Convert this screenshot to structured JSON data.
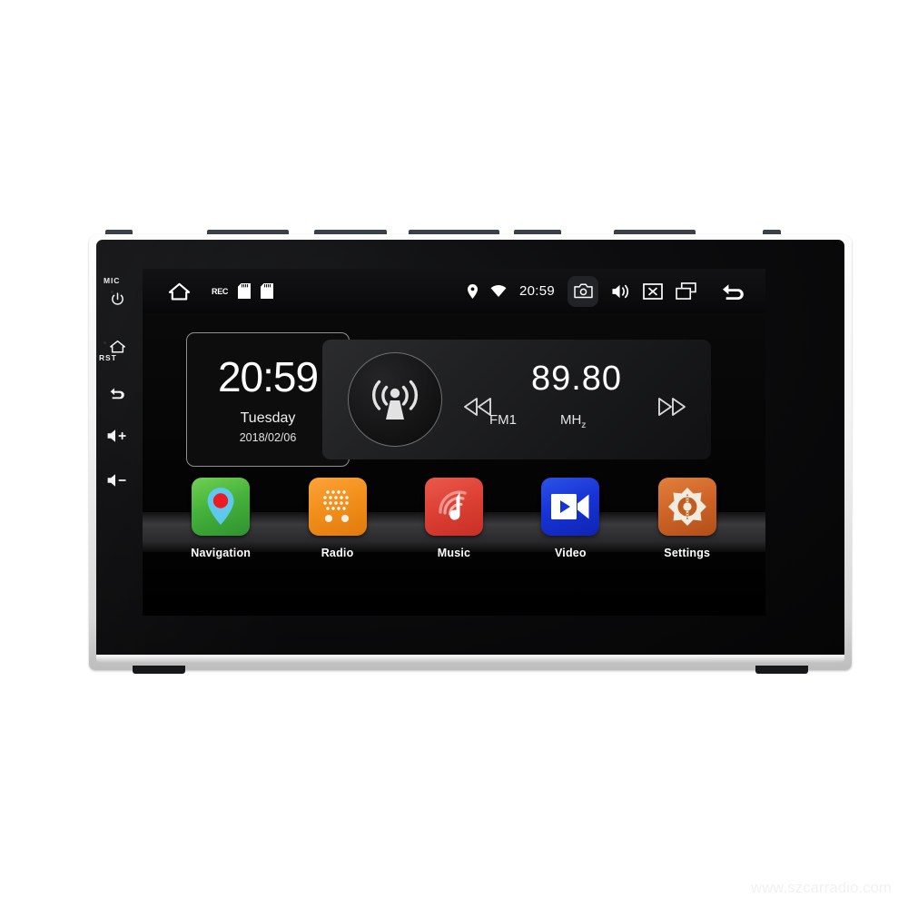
{
  "device": {
    "name": "android-car-stereo-head-unit",
    "bezel": {
      "mic_label": "MIC",
      "rst_label": "RST",
      "buttons": [
        {
          "name": "power-button",
          "icon": "power-icon"
        },
        {
          "name": "home-button",
          "icon": "home-icon"
        },
        {
          "name": "back-button",
          "icon": "back-arrow-icon"
        },
        {
          "name": "volume-up-button",
          "icon": "volume-up-icon"
        },
        {
          "name": "volume-down-button",
          "icon": "volume-down-icon"
        }
      ]
    }
  },
  "statusbar": {
    "home_icon": "home-icon",
    "rec_label": "REC",
    "sdcard1_icon": "sd-card-icon",
    "sdcard2_icon": "sd-card-icon",
    "location_icon": "location-pin-icon",
    "wifi_icon": "wifi-icon",
    "time": "20:59",
    "camera_icon": "camera-icon",
    "volume_icon": "speaker-icon",
    "close_icon": "close-box-icon",
    "recents_icon": "recent-apps-icon",
    "back_icon": "back-arrow-icon"
  },
  "clock_widget": {
    "time": "20:59",
    "day": "Tuesday",
    "date": "2018/02/06"
  },
  "radio_widget": {
    "antenna_icon": "broadcast-antenna-icon",
    "frequency": "89.80",
    "band": "FM1",
    "unit_main": "MH",
    "unit_sub": "z",
    "prev_icon": "seek-backward-icon",
    "next_icon": "seek-forward-icon"
  },
  "dock": {
    "apps": [
      {
        "label": "Navigation",
        "icon": "map-pin-icon",
        "color": "#3faa38"
      },
      {
        "label": "Radio",
        "icon": "radio-grille-icon",
        "color": "#f18a17"
      },
      {
        "label": "Music",
        "icon": "music-note-icon",
        "color": "#df3b31"
      },
      {
        "label": "Video",
        "icon": "video-camera-icon",
        "color": "#1336d8"
      },
      {
        "label": "Settings",
        "icon": "gear-icon",
        "color": "#d4692c"
      }
    ]
  },
  "watermark": {
    "text": "www.szcarradio.com"
  },
  "colors": {
    "accent_nav": "#3faa38",
    "accent_radio": "#f18a17",
    "accent_music": "#df3b31",
    "accent_video": "#1336d8",
    "accent_settings": "#d4692c",
    "bezel": "#0c0c0e",
    "chrome": "#f2f2f2"
  }
}
